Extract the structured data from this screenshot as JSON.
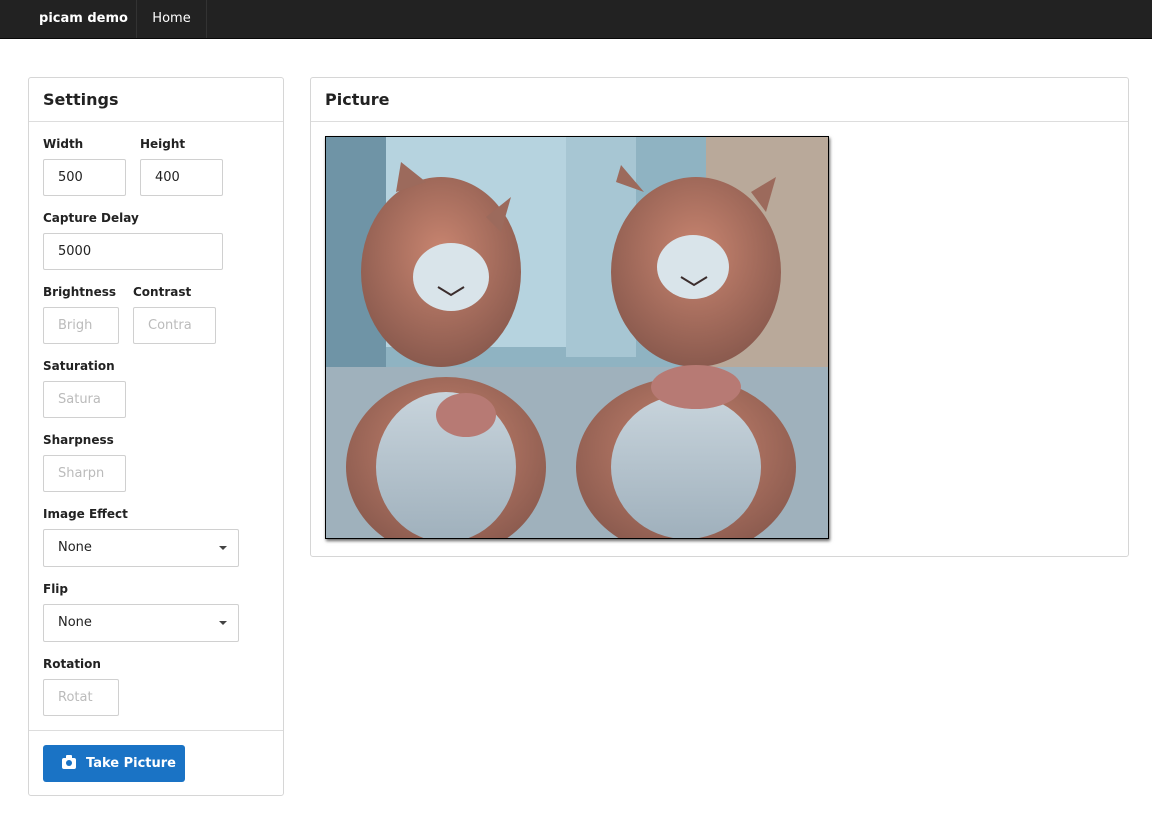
{
  "navbar": {
    "brand": "picam demo",
    "home": "Home"
  },
  "settings": {
    "title": "Settings",
    "width": {
      "label": "Width",
      "value": "500"
    },
    "height": {
      "label": "Height",
      "value": "400"
    },
    "capture_delay": {
      "label": "Capture Delay",
      "value": "5000"
    },
    "brightness": {
      "label": "Brightness",
      "placeholder": "Brigh"
    },
    "contrast": {
      "label": "Contrast",
      "placeholder": "Contra"
    },
    "saturation": {
      "label": "Saturation",
      "placeholder": "Satura"
    },
    "sharpness": {
      "label": "Sharpness",
      "placeholder": "Sharpn"
    },
    "image_effect": {
      "label": "Image Effect",
      "selected": "None"
    },
    "flip": {
      "label": "Flip",
      "selected": "None"
    },
    "rotation": {
      "label": "Rotation",
      "placeholder": "Rotat"
    },
    "take_picture": {
      "label": "Take Picture",
      "icon": "camera-icon"
    }
  },
  "picture": {
    "title": "Picture",
    "image": "photo of two plush hamster toys"
  }
}
